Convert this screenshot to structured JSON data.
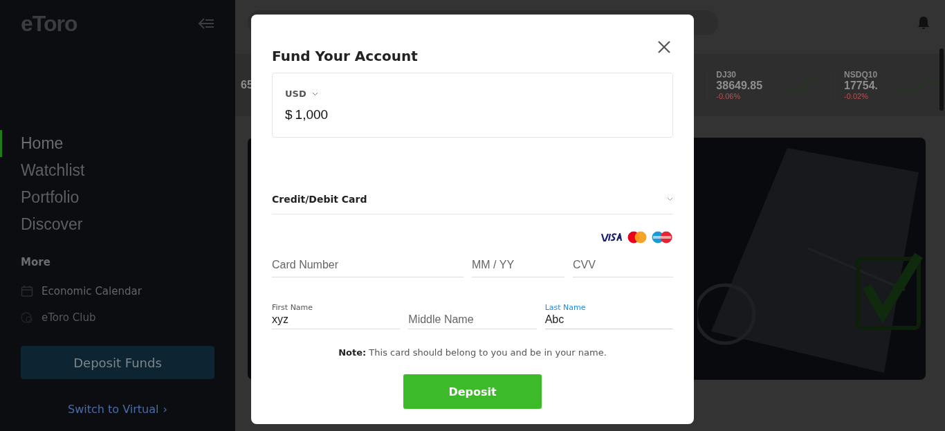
{
  "sidebar": {
    "logo": "eToro",
    "nav": [
      {
        "label": "Home",
        "selected": true
      },
      {
        "label": "Watchlist",
        "selected": false
      },
      {
        "label": "Portfolio",
        "selected": false
      },
      {
        "label": "Discover",
        "selected": false
      }
    ],
    "more_heading": "More",
    "more_items": [
      {
        "label": "Economic Calendar",
        "kind": "calendar"
      },
      {
        "label": "eToro Club",
        "kind": "club"
      }
    ],
    "deposit_button": "Deposit Funds",
    "switch_link": "Switch to Virtual",
    "switch_chevron": "›"
  },
  "tickers": [
    {
      "price": "65"
    },
    {
      "symbol": "DJ30",
      "price": "38649.85",
      "change": "-0.06%"
    },
    {
      "symbol": "NSDQ10",
      "price": "17754.",
      "change": "-0.02%"
    }
  ],
  "dialog": {
    "title": "Fund Your Account",
    "currency": "USD",
    "amount_symbol": "$",
    "amount": "1,000",
    "payment_method": "Credit/Debit Card",
    "card_fields": [
      {
        "placeholder": "Card Number"
      },
      {
        "placeholder": "MM / YY"
      },
      {
        "placeholder": "CVV"
      }
    ],
    "name_fields": [
      {
        "label": "First Name",
        "value": "xyz",
        "focused": false
      },
      {
        "placeholder": "Middle Name",
        "focused": false
      },
      {
        "label": "Last Name",
        "value": "Abc",
        "focused": true
      }
    ],
    "note_label": "Note:",
    "note": "This card should belong to you and be in your name.",
    "deposit_button": "Deposit"
  }
}
